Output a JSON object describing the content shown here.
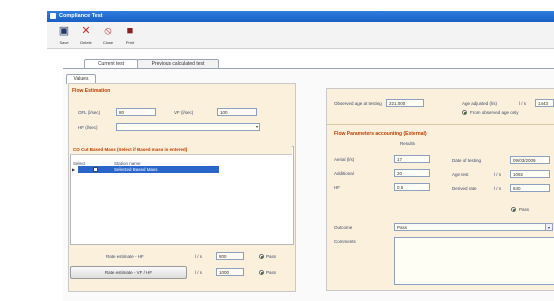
{
  "window": {
    "title": "Compliance Test"
  },
  "toolbar": {
    "items": [
      "Save",
      "Delete",
      "Close",
      "Print"
    ]
  },
  "tabs": {
    "main": [
      "Current test",
      "Previous calculated test"
    ],
    "sub": [
      "Values"
    ]
  },
  "left": {
    "flow_header": "Flow Estimation",
    "fields": {
      "flr_label": "OFL (l/sec)",
      "flr_value": "80",
      "vf_label": "VF (l/sec)",
      "vf_value": "100",
      "hf_label": "HF (l/sec)",
      "hf_value": ""
    },
    "mass_header": "CO Cut Based Mass (Select if Based mass is entered)",
    "mass_table": {
      "columns": [
        "Select",
        "Station name"
      ],
      "rows": [
        {
          "name": "Selected Based Mass"
        }
      ]
    },
    "bottom": {
      "calc_label": "Rate estimate - HF",
      "unit_a": "l / s",
      "value_a": "800",
      "flag_a": "Pass",
      "button_label": "Rate estimate - VF / HF",
      "unit_b": "l / s",
      "value_b": "1000",
      "flag_b": "Pass"
    }
  },
  "right": {
    "top": {
      "label": "Observed age at testing",
      "value": "221.000",
      "label2": "Age adjusted (l/s)",
      "unit2": "l / s",
      "value2": "1443",
      "radio_label": "From observed age only"
    },
    "flow_header": "Flow Parameters accounting (External)",
    "col_header": "Results",
    "fields": [
      {
        "label": "Aerial (l/s)",
        "value": "17"
      },
      {
        "label": "Additional",
        "value": "20"
      },
      {
        "label": "HF",
        "value": "0.5"
      }
    ],
    "right_fields": [
      {
        "label": "Date of testing",
        "value": "09/03/2009"
      },
      {
        "label": "Age test",
        "unit": "l / s",
        "value": "1092"
      },
      {
        "label": "Derived rate",
        "unit": "l / s",
        "value": "840"
      }
    ],
    "pass_label": "Pass",
    "outcome_label": "Outcome",
    "outcome_value": "Pass",
    "comments_label": "Comments"
  },
  "colors": {
    "accent": "#1a5fc2",
    "panel": "#fbf0dc",
    "selection": "#2a66c9"
  },
  "icons": [
    "save-icon",
    "delete-icon",
    "close-icon",
    "print-icon"
  ]
}
